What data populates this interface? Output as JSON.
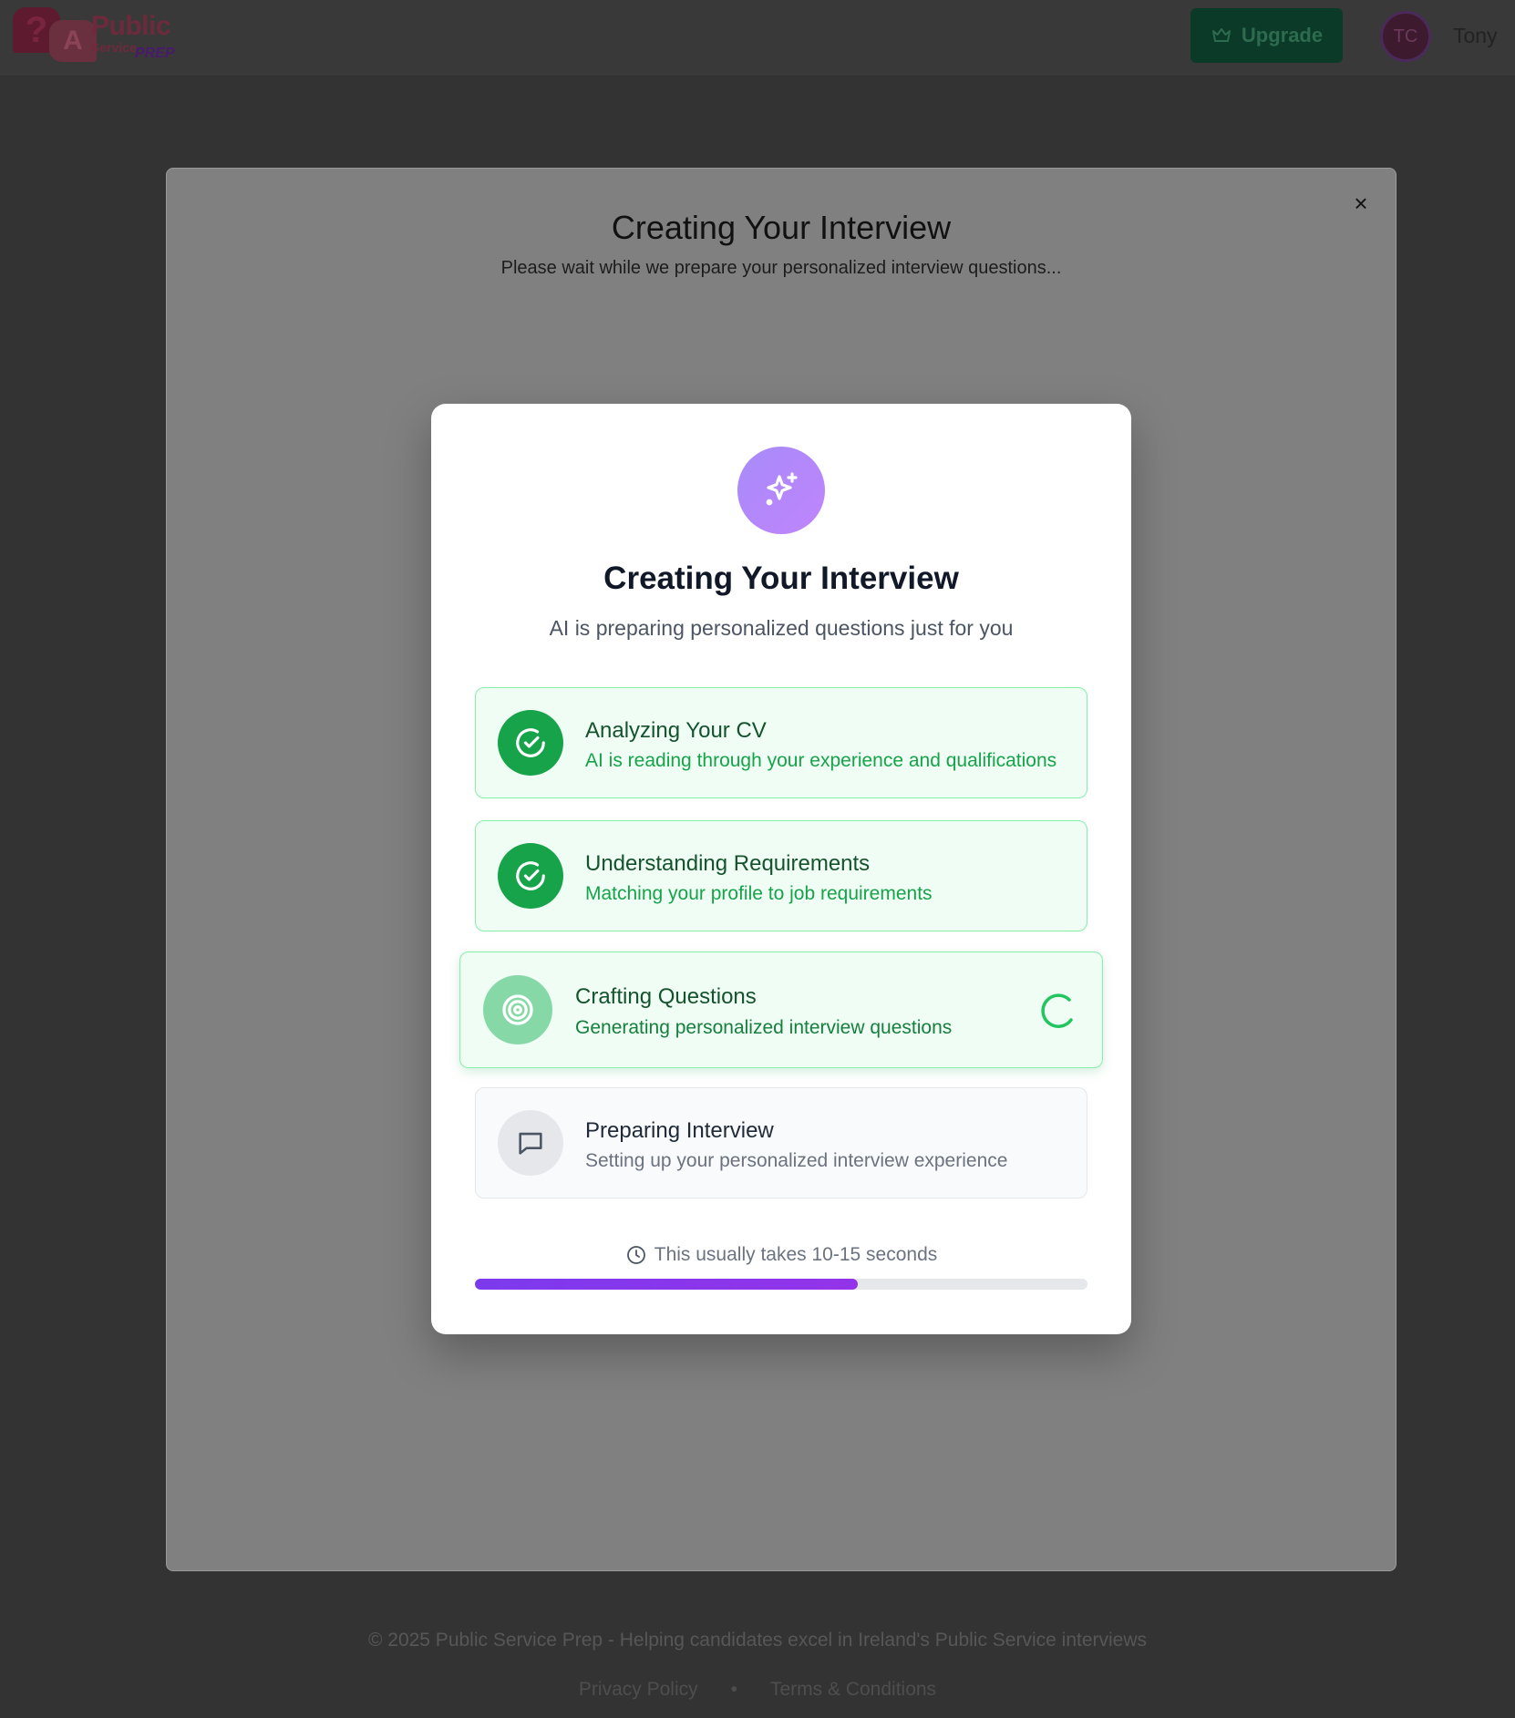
{
  "header": {
    "logo": {
      "word_main": "Public",
      "word_service": "Service",
      "word_prep": "PREP"
    },
    "upgrade_label": "Upgrade",
    "upgrade_icon": "crown-icon",
    "avatar_initials": "TC",
    "username": "Tony"
  },
  "outer_dialog": {
    "title": "Creating Your Interview",
    "subtitle": "Please wait while we prepare your personalized interview questions...",
    "close_symbol": "×"
  },
  "modal": {
    "icon": "sparkles-icon",
    "title": "Creating Your Interview",
    "subtitle": "AI is preparing personalized questions just for you",
    "steps": [
      {
        "title": "Analyzing Your CV",
        "description": "AI is reading through your experience and qualifications",
        "status": "done",
        "icon": "check-circle-icon"
      },
      {
        "title": "Understanding Requirements",
        "description": "Matching your profile to job requirements",
        "status": "done",
        "icon": "check-circle-icon"
      },
      {
        "title": "Crafting Questions",
        "description": "Generating personalized interview questions",
        "status": "active",
        "icon": "target-icon"
      },
      {
        "title": "Preparing Interview",
        "description": "Setting up your personalized interview experience",
        "status": "pending",
        "icon": "message-square-icon"
      }
    ],
    "time_note": "This usually takes 10-15 seconds",
    "progress_percent": 62.5
  },
  "footer": {
    "copyright": "© 2025 Public Service Prep - Helping candidates excel in Ireland's Public Service interviews",
    "links": [
      "Privacy Policy",
      "Terms & Conditions"
    ],
    "separator": "•"
  },
  "colors": {
    "accent_green": "#16a34a",
    "accent_purple": "#7c3aed",
    "overlay": "#333333"
  }
}
